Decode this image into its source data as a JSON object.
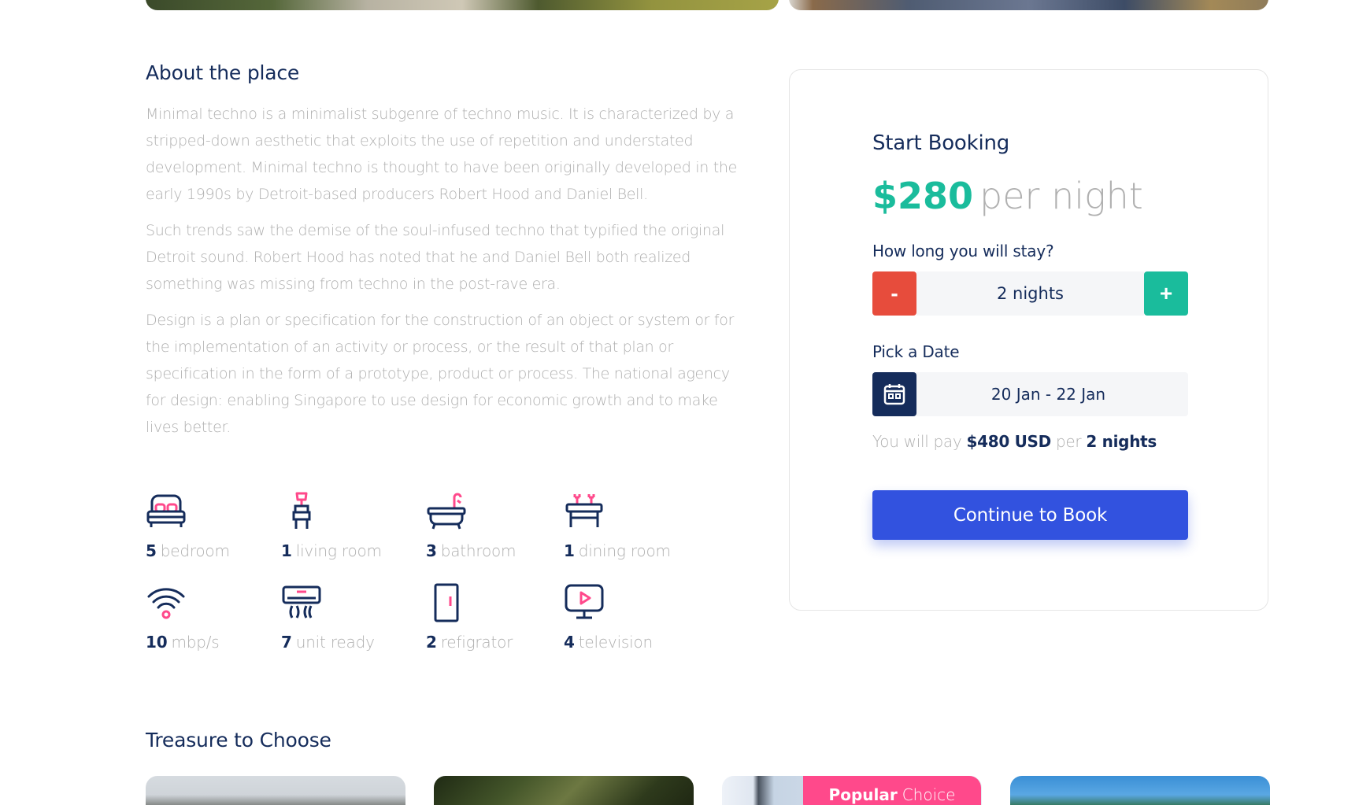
{
  "about": {
    "title": "About the place",
    "paragraphs": [
      "Minimal techno is a minimalist subgenre of techno music. It is characterized by a stripped-down aesthetic that exploits the use of repetition and understated development. Minimal techno is thought to have been originally developed in the early 1990s by Detroit-based producers Robert Hood and Daniel Bell.",
      "Such trends saw the demise of the soul-infused techno that typified the original Detroit sound. Robert Hood has noted that he and Daniel Bell both realized something was missing from techno in the post-rave era.",
      "Design is a plan or specification for the construction of an object or system or for the implementation of an activity or process, or the result of that plan or specification in the form of a prototype, product or process. The national agency for design: enabling Singapore to use design for economic growth and to make lives better."
    ]
  },
  "features": [
    {
      "icon": "bed-icon",
      "count": "5",
      "label": "bedroom"
    },
    {
      "icon": "lamp-chair-icon",
      "count": "1",
      "label": "living room"
    },
    {
      "icon": "bathtub-icon",
      "count": "3",
      "label": "bathroom"
    },
    {
      "icon": "dining-table-icon",
      "count": "1",
      "label": "dining room"
    },
    {
      "icon": "wifi-icon",
      "count": "10",
      "label": "mbp/s"
    },
    {
      "icon": "air-conditioner-icon",
      "count": "7",
      "label": "unit ready"
    },
    {
      "icon": "refrigerator-icon",
      "count": "2",
      "label": "refigrator"
    },
    {
      "icon": "television-icon",
      "count": "4",
      "label": "television"
    }
  ],
  "booking": {
    "title": "Start Booking",
    "price": "$280",
    "per": "per night",
    "stay_label": "How long you will stay?",
    "minus_label": "-",
    "plus_label": "+",
    "stay_value": "2 nights",
    "date_label": "Pick a Date",
    "date_value": "20 Jan - 22 Jan",
    "pay_prefix": "You will pay",
    "pay_amount": "$480 USD",
    "pay_per": "per",
    "pay_nights": "2 nights",
    "continue_label": "Continue to Book"
  },
  "treasure": {
    "title": "Treasure to Choose",
    "popular_bold": "Popular",
    "popular_light": "Choice"
  },
  "colors": {
    "primary": "#152C5B",
    "accent_green": "#1ABC9C",
    "accent_red": "#E74C3C",
    "button_blue": "#3252DF",
    "popular_pink": "#FF498B",
    "muted": "#B0B0B0"
  }
}
